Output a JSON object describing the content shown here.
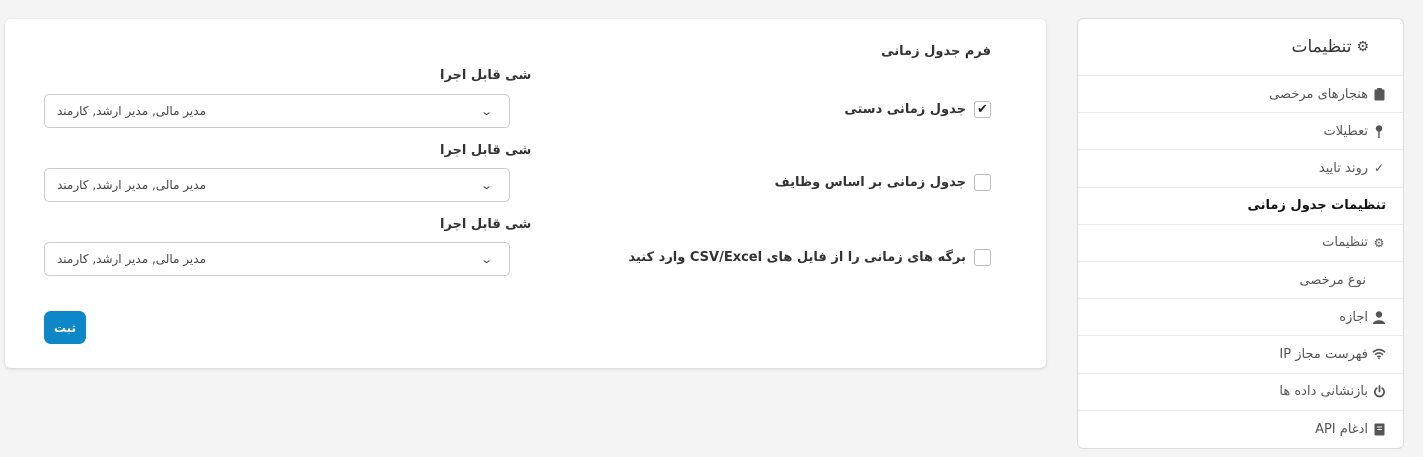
{
  "sidebar": {
    "title": "تنظیمات",
    "title_icon": "gears-icon",
    "items": [
      {
        "label": "هنجارهای مرخصی",
        "icon": "clipboard-icon"
      },
      {
        "label": "تعطیلات",
        "icon": "pin-icon"
      },
      {
        "label": "روند تایید",
        "icon": "check-icon"
      },
      {
        "label": "تنظیمات جدول زمانی",
        "icon": "",
        "active": true
      },
      {
        "label": "تنظیمات",
        "icon": "gear-icon"
      },
      {
        "label": "نوع مرخصی",
        "icon": ""
      },
      {
        "label": "اجازه",
        "icon": "user-icon"
      },
      {
        "label": "فهرست مجاز IP",
        "icon": "wifi-icon"
      },
      {
        "label": "بازنشانی داده ها",
        "icon": "power-icon"
      },
      {
        "label": "ادغام API",
        "icon": "book-icon"
      }
    ]
  },
  "form": {
    "title": "فرم جدول زمانی",
    "rows": [
      {
        "checkbox_label": "جدول زمانی دستی",
        "checked": true,
        "field_label": "شی قابل اجرا",
        "select_value": "مدیر مالی, مدیر ارشد, کارمند"
      },
      {
        "checkbox_label": "جدول زمانی بر اساس وظایف",
        "checked": false,
        "field_label": "شی قابل اجرا",
        "select_value": "مدیر مالی, مدیر ارشد, کارمند"
      },
      {
        "checkbox_label": "برگه های زمانی را از فایل های CSV/Excel وارد کنید",
        "checked": false,
        "field_label": "شی قابل اجرا",
        "select_value": "مدیر مالی, مدیر ارشد, کارمند"
      }
    ],
    "submit_label": "ثبت"
  },
  "colors": {
    "accent": "#0d87c8",
    "background": "#f4f4f4"
  }
}
